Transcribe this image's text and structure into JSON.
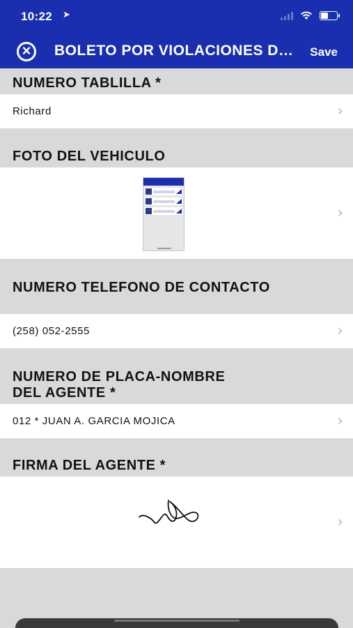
{
  "status": {
    "time": "10:22",
    "location_icon": "location-arrow-icon",
    "signal_icon": "cellular-signal-icon",
    "wifi_icon": "wifi-icon",
    "battery_icon": "battery-icon",
    "battery_level": 0.45
  },
  "nav": {
    "close_icon": "close-circle-icon",
    "title": "BOLETO POR VIOLACIONES DE TRANSITO",
    "save_label": "Save"
  },
  "sections": [
    {
      "label": "NUMERO TABLILLA *",
      "value": "Richard"
    },
    {
      "label": "FOTO DEL VEHICULO",
      "value_type": "image-thumbnail"
    },
    {
      "label": "NUMERO TELEFONO DE CONTACTO",
      "value": "(258) 052-2555"
    },
    {
      "label_line1": "NUMERO DE PLACA-NOMBRE",
      "label_line2": "DEL AGENTE *",
      "value": "012 * JUAN A. GARCIA MOJICA"
    },
    {
      "label": "FIRMA DEL AGENTE *",
      "value_type": "signature"
    }
  ],
  "colors": {
    "header_bg": "#1a2fb0",
    "section_bg": "#d9d9d9",
    "row_bg": "#ffffff",
    "chevron": "#b9b9b9"
  },
  "chevron_icon": "chevron-right-icon"
}
